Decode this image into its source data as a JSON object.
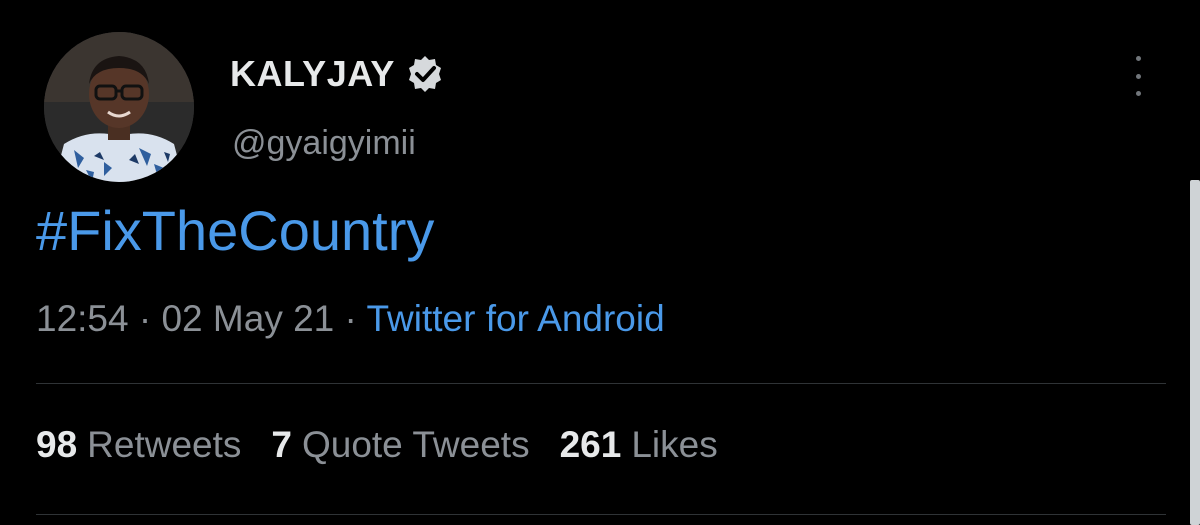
{
  "user": {
    "display_name": "KALYJAY",
    "handle": "@gyaigyimii",
    "verified": true
  },
  "tweet": {
    "text": "#FixTheCountry",
    "time": "12:54",
    "separator": "·",
    "date": "02 May 21",
    "source": "Twitter for Android"
  },
  "stats": {
    "retweets_count": "98",
    "retweets_label": "Retweets",
    "quotes_count": "7",
    "quotes_label": "Quote Tweets",
    "likes_count": "261",
    "likes_label": "Likes"
  },
  "colors": {
    "background": "#000000",
    "link": "#4a99e9",
    "secondary_text": "#8b9096",
    "primary_text": "#e7e9ea"
  },
  "icons": {
    "verified": "verified-badge-icon",
    "more": "more-vertical-icon"
  }
}
